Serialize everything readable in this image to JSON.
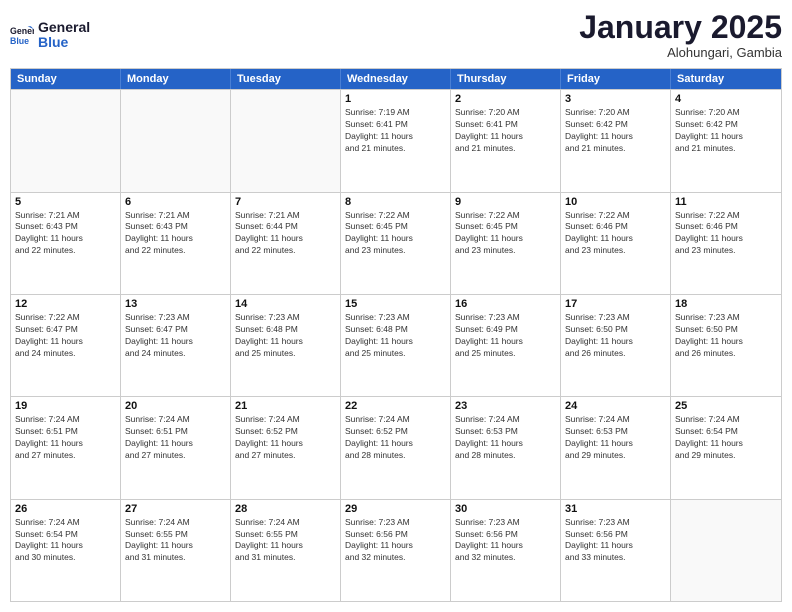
{
  "logo": {
    "text_general": "General",
    "text_blue": "Blue"
  },
  "title": "January 2025",
  "location": "Alohungari, Gambia",
  "days_of_week": [
    "Sunday",
    "Monday",
    "Tuesday",
    "Wednesday",
    "Thursday",
    "Friday",
    "Saturday"
  ],
  "weeks": [
    [
      {
        "day": "",
        "info": ""
      },
      {
        "day": "",
        "info": ""
      },
      {
        "day": "",
        "info": ""
      },
      {
        "day": "1",
        "info": "Sunrise: 7:19 AM\nSunset: 6:41 PM\nDaylight: 11 hours\nand 21 minutes."
      },
      {
        "day": "2",
        "info": "Sunrise: 7:20 AM\nSunset: 6:41 PM\nDaylight: 11 hours\nand 21 minutes."
      },
      {
        "day": "3",
        "info": "Sunrise: 7:20 AM\nSunset: 6:42 PM\nDaylight: 11 hours\nand 21 minutes."
      },
      {
        "day": "4",
        "info": "Sunrise: 7:20 AM\nSunset: 6:42 PM\nDaylight: 11 hours\nand 21 minutes."
      }
    ],
    [
      {
        "day": "5",
        "info": "Sunrise: 7:21 AM\nSunset: 6:43 PM\nDaylight: 11 hours\nand 22 minutes."
      },
      {
        "day": "6",
        "info": "Sunrise: 7:21 AM\nSunset: 6:43 PM\nDaylight: 11 hours\nand 22 minutes."
      },
      {
        "day": "7",
        "info": "Sunrise: 7:21 AM\nSunset: 6:44 PM\nDaylight: 11 hours\nand 22 minutes."
      },
      {
        "day": "8",
        "info": "Sunrise: 7:22 AM\nSunset: 6:45 PM\nDaylight: 11 hours\nand 23 minutes."
      },
      {
        "day": "9",
        "info": "Sunrise: 7:22 AM\nSunset: 6:45 PM\nDaylight: 11 hours\nand 23 minutes."
      },
      {
        "day": "10",
        "info": "Sunrise: 7:22 AM\nSunset: 6:46 PM\nDaylight: 11 hours\nand 23 minutes."
      },
      {
        "day": "11",
        "info": "Sunrise: 7:22 AM\nSunset: 6:46 PM\nDaylight: 11 hours\nand 23 minutes."
      }
    ],
    [
      {
        "day": "12",
        "info": "Sunrise: 7:22 AM\nSunset: 6:47 PM\nDaylight: 11 hours\nand 24 minutes."
      },
      {
        "day": "13",
        "info": "Sunrise: 7:23 AM\nSunset: 6:47 PM\nDaylight: 11 hours\nand 24 minutes."
      },
      {
        "day": "14",
        "info": "Sunrise: 7:23 AM\nSunset: 6:48 PM\nDaylight: 11 hours\nand 25 minutes."
      },
      {
        "day": "15",
        "info": "Sunrise: 7:23 AM\nSunset: 6:48 PM\nDaylight: 11 hours\nand 25 minutes."
      },
      {
        "day": "16",
        "info": "Sunrise: 7:23 AM\nSunset: 6:49 PM\nDaylight: 11 hours\nand 25 minutes."
      },
      {
        "day": "17",
        "info": "Sunrise: 7:23 AM\nSunset: 6:50 PM\nDaylight: 11 hours\nand 26 minutes."
      },
      {
        "day": "18",
        "info": "Sunrise: 7:23 AM\nSunset: 6:50 PM\nDaylight: 11 hours\nand 26 minutes."
      }
    ],
    [
      {
        "day": "19",
        "info": "Sunrise: 7:24 AM\nSunset: 6:51 PM\nDaylight: 11 hours\nand 27 minutes."
      },
      {
        "day": "20",
        "info": "Sunrise: 7:24 AM\nSunset: 6:51 PM\nDaylight: 11 hours\nand 27 minutes."
      },
      {
        "day": "21",
        "info": "Sunrise: 7:24 AM\nSunset: 6:52 PM\nDaylight: 11 hours\nand 27 minutes."
      },
      {
        "day": "22",
        "info": "Sunrise: 7:24 AM\nSunset: 6:52 PM\nDaylight: 11 hours\nand 28 minutes."
      },
      {
        "day": "23",
        "info": "Sunrise: 7:24 AM\nSunset: 6:53 PM\nDaylight: 11 hours\nand 28 minutes."
      },
      {
        "day": "24",
        "info": "Sunrise: 7:24 AM\nSunset: 6:53 PM\nDaylight: 11 hours\nand 29 minutes."
      },
      {
        "day": "25",
        "info": "Sunrise: 7:24 AM\nSunset: 6:54 PM\nDaylight: 11 hours\nand 29 minutes."
      }
    ],
    [
      {
        "day": "26",
        "info": "Sunrise: 7:24 AM\nSunset: 6:54 PM\nDaylight: 11 hours\nand 30 minutes."
      },
      {
        "day": "27",
        "info": "Sunrise: 7:24 AM\nSunset: 6:55 PM\nDaylight: 11 hours\nand 31 minutes."
      },
      {
        "day": "28",
        "info": "Sunrise: 7:24 AM\nSunset: 6:55 PM\nDaylight: 11 hours\nand 31 minutes."
      },
      {
        "day": "29",
        "info": "Sunrise: 7:23 AM\nSunset: 6:56 PM\nDaylight: 11 hours\nand 32 minutes."
      },
      {
        "day": "30",
        "info": "Sunrise: 7:23 AM\nSunset: 6:56 PM\nDaylight: 11 hours\nand 32 minutes."
      },
      {
        "day": "31",
        "info": "Sunrise: 7:23 AM\nSunset: 6:56 PM\nDaylight: 11 hours\nand 33 minutes."
      },
      {
        "day": "",
        "info": ""
      }
    ]
  ]
}
